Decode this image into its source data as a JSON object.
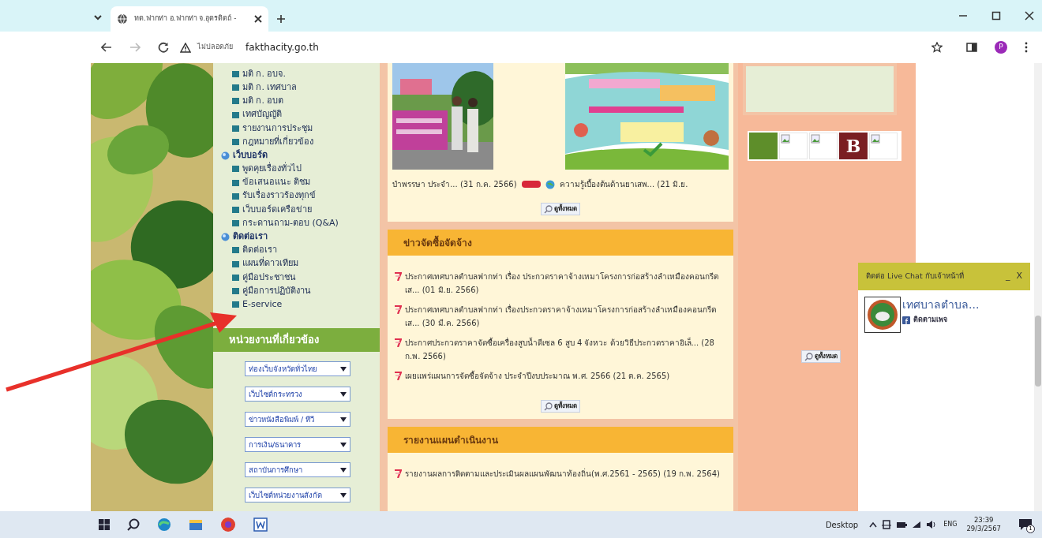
{
  "browser": {
    "tab_title": "ทต.ฟากท่า อ.ฟากท่า จ.อุตรดิตถ์ - ",
    "security": "ไม่ปลอดภัย",
    "url": "fakthacity.go.th",
    "profile": "P"
  },
  "sidebar": {
    "groups": [
      {
        "items": [
          "มติ ก. อบจ.",
          "มติ ก. เทศบาล",
          "มติ ก. อบต",
          "เทศบัญญัติ",
          "รายงานการประชุม",
          "กฎหมายที่เกี่ยวข้อง"
        ]
      },
      {
        "title": "เว็บบอร์ด",
        "items": [
          "พูดคุยเรื่องทั่วไป",
          "ข้อเสนอแนะ ติชม",
          "รับเรื่องราวร้องทุกข์",
          "เว็บบอร์ดเครือข่าย",
          "กระดานถาม-ตอบ (Q&A)"
        ]
      },
      {
        "title": "ติดต่อเรา",
        "items": [
          "ติดต่อเรา",
          "แผนที่ดาวเทียม",
          "คู่มือประชาชน",
          "คู่มือการปฏิบัติงาน",
          "E-service"
        ]
      }
    ],
    "links_title": "หน่วยงานที่เกี่ยวข้อง",
    "dropdowns": [
      "ท่องเว็บจังหวัดทั่วไทย",
      "เว็บไซต์กระทรวง",
      "ข่าวหนังสือพิมพ์ / ทีวี",
      "การเงิน/ธนาคาร",
      "สถาบันการศึกษา",
      "เว็บไซต์หน่วยงานสังกัด"
    ]
  },
  "gallery": {
    "captions": [
      {
        "kind": "plain",
        "text": "บำพรรษา ประจำ... (31 ก.ค. 2566)"
      },
      {
        "kind": "new",
        "text": "ความรู้เบื้องต้นด้านยาเสพ... (21 มิ.ย."
      }
    ],
    "more": "ดูทั้งหมด"
  },
  "sections": [
    {
      "title": "ข่าวจัดซื้อจัดจ้าง",
      "items": [
        "ประกาศเทศบาลตำบลฟากท่า เรื่อง ประกวดราคาจ้างเหมาโครงการก่อสร้างลำเหมืองคอนกรีตเส... (01 มิ.ย. 2566)",
        "ประกาศเทศบาลตำบลฟากท่า เรื่องประกวดราคาจ้างเหมาโครงการก่อสร้างลำเหมืองคอนกรีตเส... (30 มี.ค. 2566)",
        "ประกาศประกวดราคาจัดซื้อเครื่องสูบน้ำดีเซล 6 สูบ 4 จังหวะ ด้วยวิธีประกวดราคาอิเล็... (28 ก.พ. 2566)",
        "เผยแพร่แผนการจัดซื้อจัดจ้าง ประจำปีงบประมาณ พ.ศ. 2566 (21 ต.ค. 2565)"
      ],
      "more": "ดูทั้งหมด"
    },
    {
      "title": "รายงานแผนดำเนินงาน",
      "items": [
        "รายงานผลการติดตามและประเมินผลแผนพัฒนาท้องถิ่น(พ.ศ.2561 - 2565) (19 ก.พ. 2564)"
      ]
    }
  ],
  "right": {
    "badges": [
      {
        "kind": "green"
      },
      {
        "kind": "broken"
      },
      {
        "kind": "broken"
      },
      {
        "kind": "letter",
        "text": "B"
      },
      {
        "kind": "broken"
      }
    ],
    "more": "ดูทั้งหมด"
  },
  "chat": {
    "title": "ติดต่อ Live Chat กับเจ้าหน้าที่",
    "minimize": "_",
    "close": "X",
    "page_name": "เทศบาลตำบล...",
    "follow": "ติดตามเพจ"
  },
  "taskbar": {
    "desktop": "Desktop",
    "language": "ENG",
    "time": "23:39",
    "date": "29/3/2567",
    "notifications": "1"
  }
}
